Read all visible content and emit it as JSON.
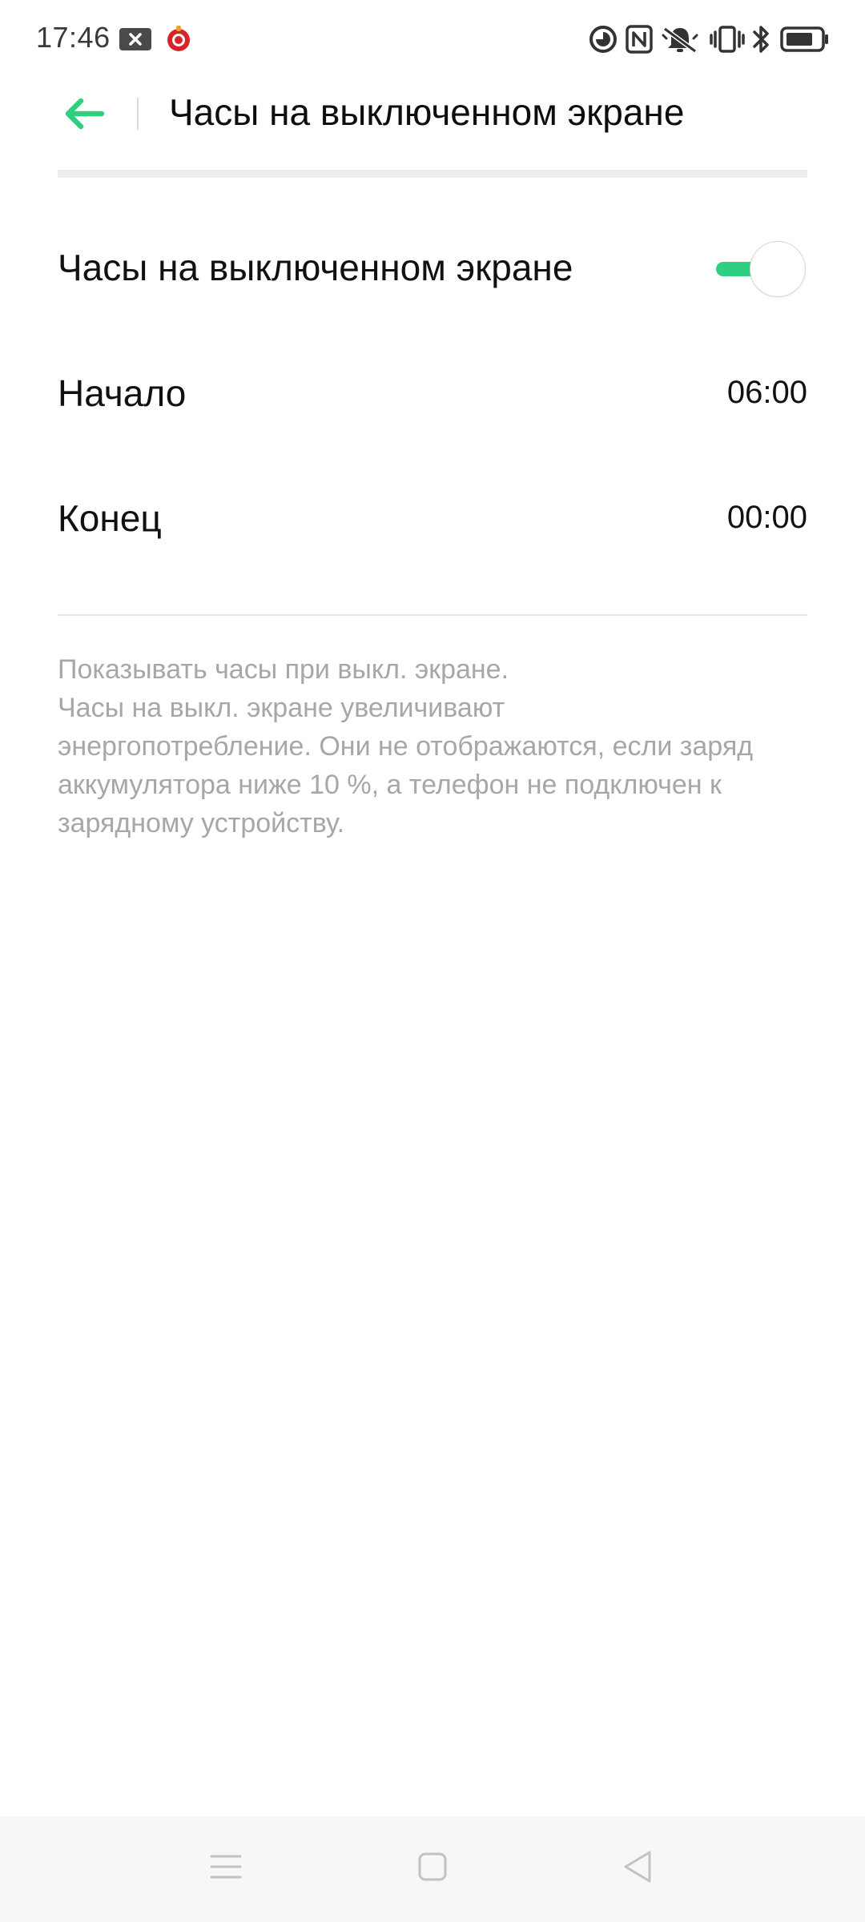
{
  "status_bar": {
    "time": "17:46",
    "left_icons": [
      "notification-close-icon",
      "app-notification-icon"
    ],
    "right_icons": [
      "data-saver-icon",
      "nfc-icon",
      "mute-icon",
      "vibrate-icon",
      "bluetooth-icon",
      "battery-icon"
    ]
  },
  "header": {
    "back_icon": "arrow-left-icon",
    "title": "Часы на выключенном экране"
  },
  "settings": {
    "toggle_row": {
      "label": "Часы на выключенном экране",
      "enabled": true
    },
    "start_row": {
      "label": "Начало",
      "value": "06:00"
    },
    "end_row": {
      "label": "Конец",
      "value": "00:00"
    }
  },
  "description": {
    "lines": [
      "Показывать часы при выкл. экране.",
      "Часы на выкл. экране увеличивают",
      "энергопотребление. Они не отображаются, если заряд",
      "аккумулятора ниже 10 %, а телефон не подключен к",
      "зарядному устройству."
    ]
  },
  "nav_bar": {
    "buttons": [
      "menu-icon",
      "home-icon",
      "back-triangle-icon"
    ]
  },
  "colors": {
    "accent": "#2fcf7f",
    "text_primary": "#111111",
    "text_secondary": "#a7a7a7",
    "nav_background": "#f7f7f7"
  }
}
